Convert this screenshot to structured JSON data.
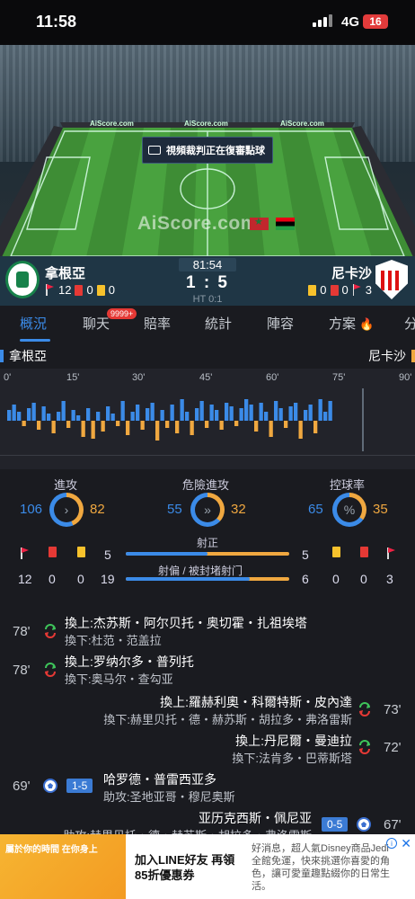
{
  "status_bar": {
    "time": "11:58",
    "network": "4G",
    "battery": "16"
  },
  "field": {
    "banner": "AiScore.com",
    "var_notice": "視頻裁判正在復審點球",
    "watermark": "AiScore.com"
  },
  "match": {
    "home": {
      "name": "拿根亞",
      "corners": "12",
      "red": "0",
      "yellow": "0"
    },
    "away": {
      "name": "尼卡沙",
      "corners": "3",
      "red": "0",
      "yellow": "0"
    },
    "time": "81:54",
    "score": "1 : 5",
    "ht": "HT 0:1"
  },
  "tabs": {
    "items": [
      "概況",
      "聊天",
      "賠率",
      "統計",
      "陣容",
      "方案",
      "分"
    ],
    "badge": "9999+",
    "active": "概況"
  },
  "team_header": {
    "home": "拿根亞",
    "away": "尼卡沙"
  },
  "timeline": {
    "ticks": [
      "0'",
      "15'",
      "30'",
      "45'",
      "60'",
      "75'",
      "90'"
    ],
    "colors": {
      "home": "#3b8be8",
      "away": "#f0a840"
    }
  },
  "stats": {
    "attack": {
      "label": "進攻",
      "home": "106",
      "away": "82",
      "home_share": 0.564
    },
    "dangerous": {
      "label": "危險進攻",
      "home": "55",
      "away": "32",
      "home_share": 0.632
    },
    "possession": {
      "label": "控球率",
      "home": "65",
      "away": "35",
      "home_share": 0.65
    },
    "shots_on": {
      "label": "射正",
      "home": "5",
      "away": "5",
      "home_share": 0.5
    },
    "shots_off": {
      "label": "射偏 / 被封堵射门",
      "home": "19",
      "away": "6",
      "home_share": 0.76
    },
    "home_counts": {
      "corners": "12",
      "red": "0",
      "yellow": "0"
    },
    "away_counts": {
      "yellow": "0",
      "red": "0",
      "corners": "3"
    }
  },
  "events": [
    {
      "minute": "78'",
      "side": "home",
      "type": "sub",
      "in": "換上:杰苏斯・阿尔贝托・奥切霍・扎祖埃塔",
      "out": "換下:杜范・范盖拉"
    },
    {
      "minute": "78'",
      "side": "home",
      "type": "sub",
      "in": "換上:罗纳尔多・普列托",
      "out": "換下:奥马尔・查勾亚"
    },
    {
      "minute": "73'",
      "side": "away",
      "type": "sub",
      "in": "換上:羅赫利奧・科爾特斯・皮內達",
      "out": "換下:赫里贝托・德・赫苏斯・胡拉多・弗洛雷斯"
    },
    {
      "minute": "72'",
      "side": "away",
      "type": "sub",
      "in": "換上:丹尼爾・曼迪拉",
      "out": "換下:法肯多・巴蒂斯塔"
    },
    {
      "minute": "69'",
      "side": "home",
      "type": "goal",
      "score": "1-5",
      "in": "哈罗德・普雷西亚多",
      "out": "助攻:圣地亚哥・穆尼奥斯"
    },
    {
      "minute": "67'",
      "side": "away",
      "type": "goal",
      "score": "0-5",
      "in": "亚历克西斯・佩尼亚",
      "out": "助攻:赫里贝托・德・赫苏斯・胡拉多・弗洛雷斯"
    }
  ],
  "ad": {
    "image_text": "屬於你的時間 在你身上",
    "title": "加入LINE好友 再領85折優惠券",
    "body": "好消息，超人氣Disney商品Jedi全館免運，快來挑選你喜愛的角色，讓可愛童趣點綴你的日常生活。"
  }
}
